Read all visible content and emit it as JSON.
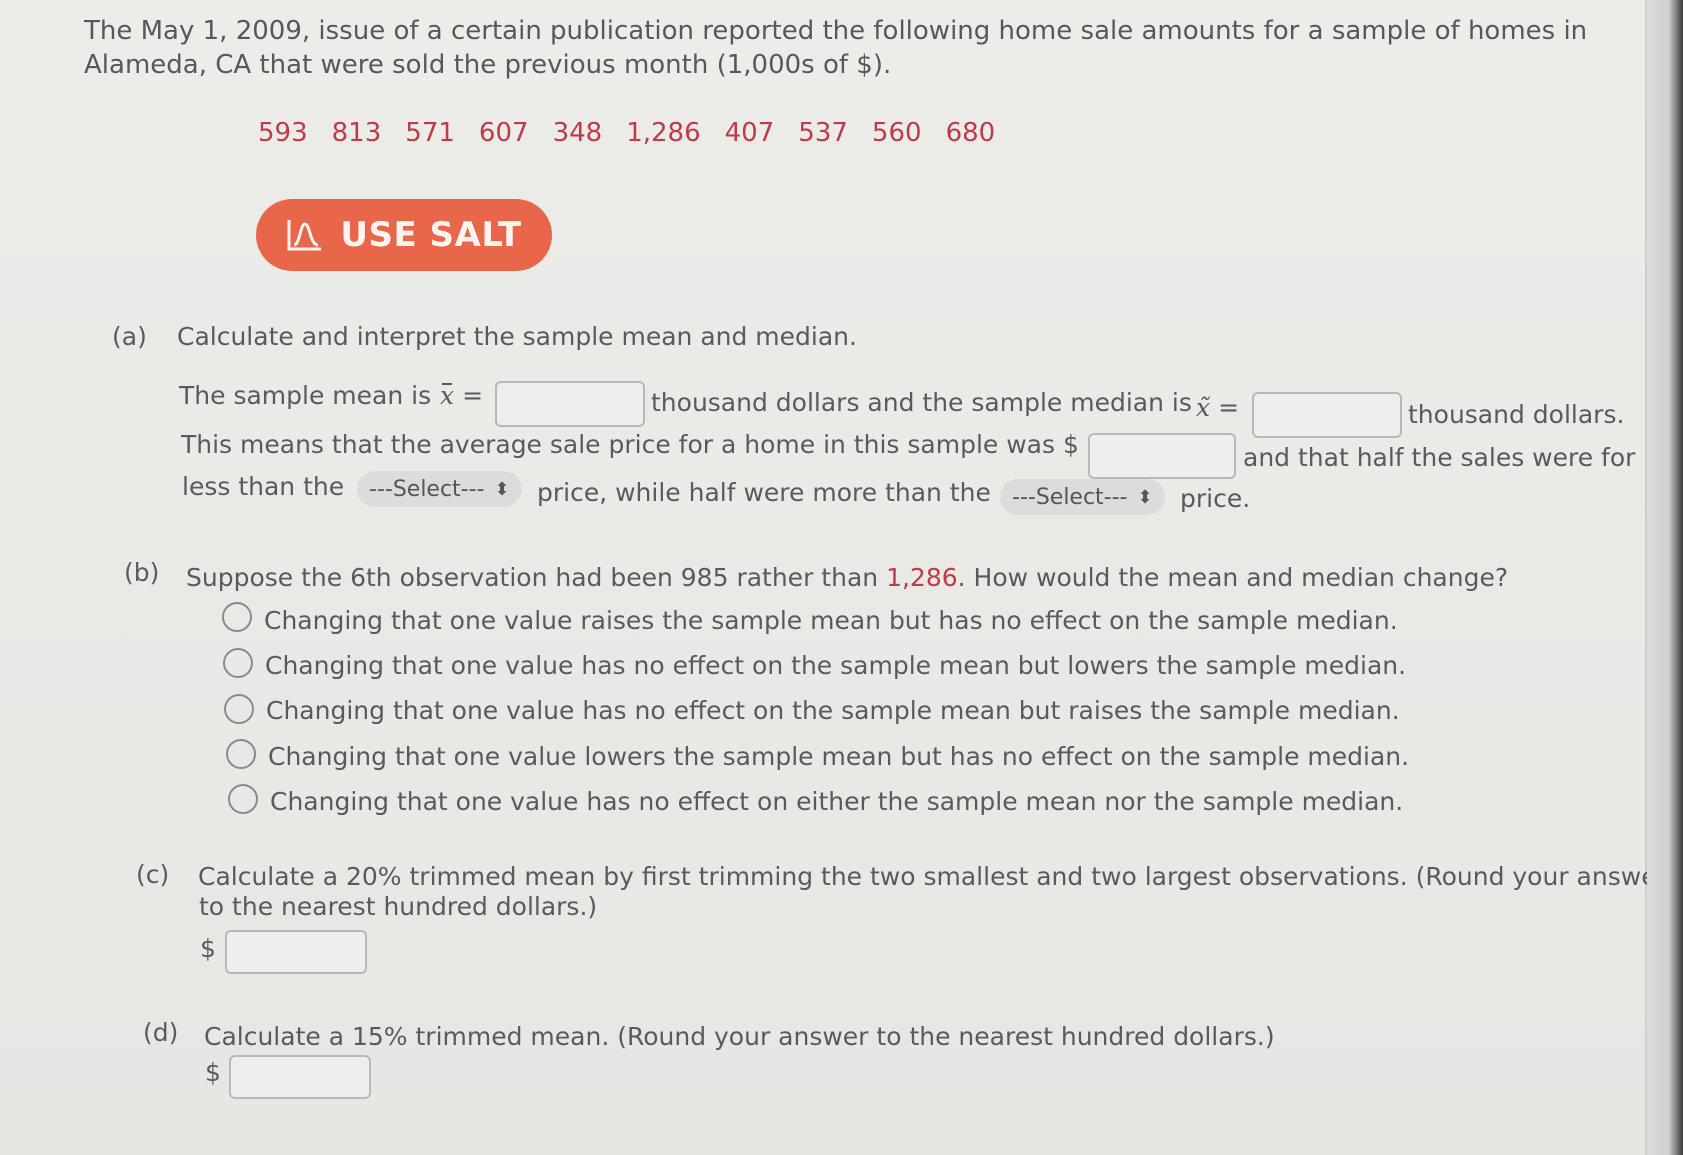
{
  "intro": {
    "line1": "The May 1, 2009, issue of a certain publication reported the following home sale amounts for a sample of homes in",
    "line2": "Alameda, CA that were sold the previous month (1,000s of $)."
  },
  "data_values": [
    "593",
    "813",
    "571",
    "607",
    "348",
    "1,286",
    "407",
    "537",
    "560",
    "680"
  ],
  "salt_button": {
    "label": "USE SALT",
    "icon": "normal-curve-icon",
    "color": "#e8664a"
  },
  "part_a": {
    "label": "(a)",
    "question": "Calculate and interpret the sample mean and median.",
    "mean_prefix": "The sample mean is",
    "mean_symbol": "x",
    "equals": "=",
    "mean_input_value": "",
    "mean_suffix": "thousand dollars and the sample median is",
    "median_symbol": "x̃",
    "median_input_value": "",
    "median_suffix": "thousand dollars.",
    "line2_prefix": "This means that the average sale price for a home in this sample was $",
    "avg_input_value": "",
    "line2_suffix": "and that half the sales were for",
    "line3_prefix": "less than the",
    "select1_value": "---Select---",
    "line3_mid": "price, while half were more than the",
    "select2_value": "---Select---",
    "line3_suffix": "price."
  },
  "part_b": {
    "label": "(b)",
    "question_prefix": "Suppose the 6th observation had been 985 rather than",
    "question_red": "1,286",
    "question_suffix": ". How would the mean and median change?",
    "options": [
      "Changing that one value raises the sample mean but has no effect on the sample median.",
      "Changing that one value has no effect on the sample mean but lowers the sample median.",
      "Changing that one value has no effect on the sample mean but raises the sample median.",
      "Changing that one value lowers the sample mean but has no effect on the sample median.",
      "Changing that one value has no effect on either the sample mean nor the sample median."
    ]
  },
  "part_c": {
    "label": "(c)",
    "line1": "Calculate a 20% trimmed mean by first trimming the two smallest and two largest observations. (Round your answer",
    "line2": "to the nearest hundred dollars.)",
    "currency": "$",
    "input_value": ""
  },
  "part_d": {
    "label": "(d)",
    "line1": "Calculate a 15% trimmed mean. (Round your answer to the nearest hundred dollars.)",
    "currency": "$",
    "input_value": ""
  }
}
